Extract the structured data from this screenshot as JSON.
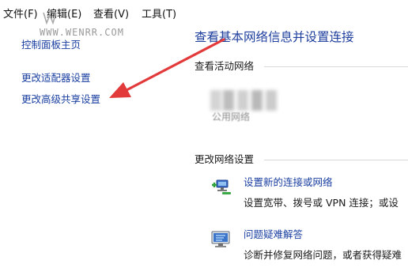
{
  "menu": {
    "file": "文件(F)",
    "edit": "编辑(E)",
    "view": "查看(V)",
    "tools": "工具(T)"
  },
  "watermark": {
    "text": "WWW.WENRR.COM"
  },
  "sidebar": {
    "items": [
      {
        "label": "控制面板主页"
      },
      {
        "label": "更改适配器设置"
      },
      {
        "label": "更改高级共享设置"
      }
    ]
  },
  "main": {
    "title": "查看基本网络信息并设置连接",
    "active_networks_heading": "查看活动网络",
    "network_type": "公用网络",
    "change_settings_heading": "更改网络设置",
    "tasks": [
      {
        "link": "设置新的连接或网络",
        "description": "设置宽带、拨号或 VPN 连接；或设",
        "icon": "network-setup-icon"
      },
      {
        "link": "问题疑难解答",
        "description": "诊断并修复网络问题，或者获得疑难",
        "icon": "troubleshoot-icon"
      }
    ]
  },
  "annotation": {
    "color": "#e23a3a"
  },
  "colors": {
    "link": "#1a3fa0",
    "title": "#1f3f9e"
  }
}
